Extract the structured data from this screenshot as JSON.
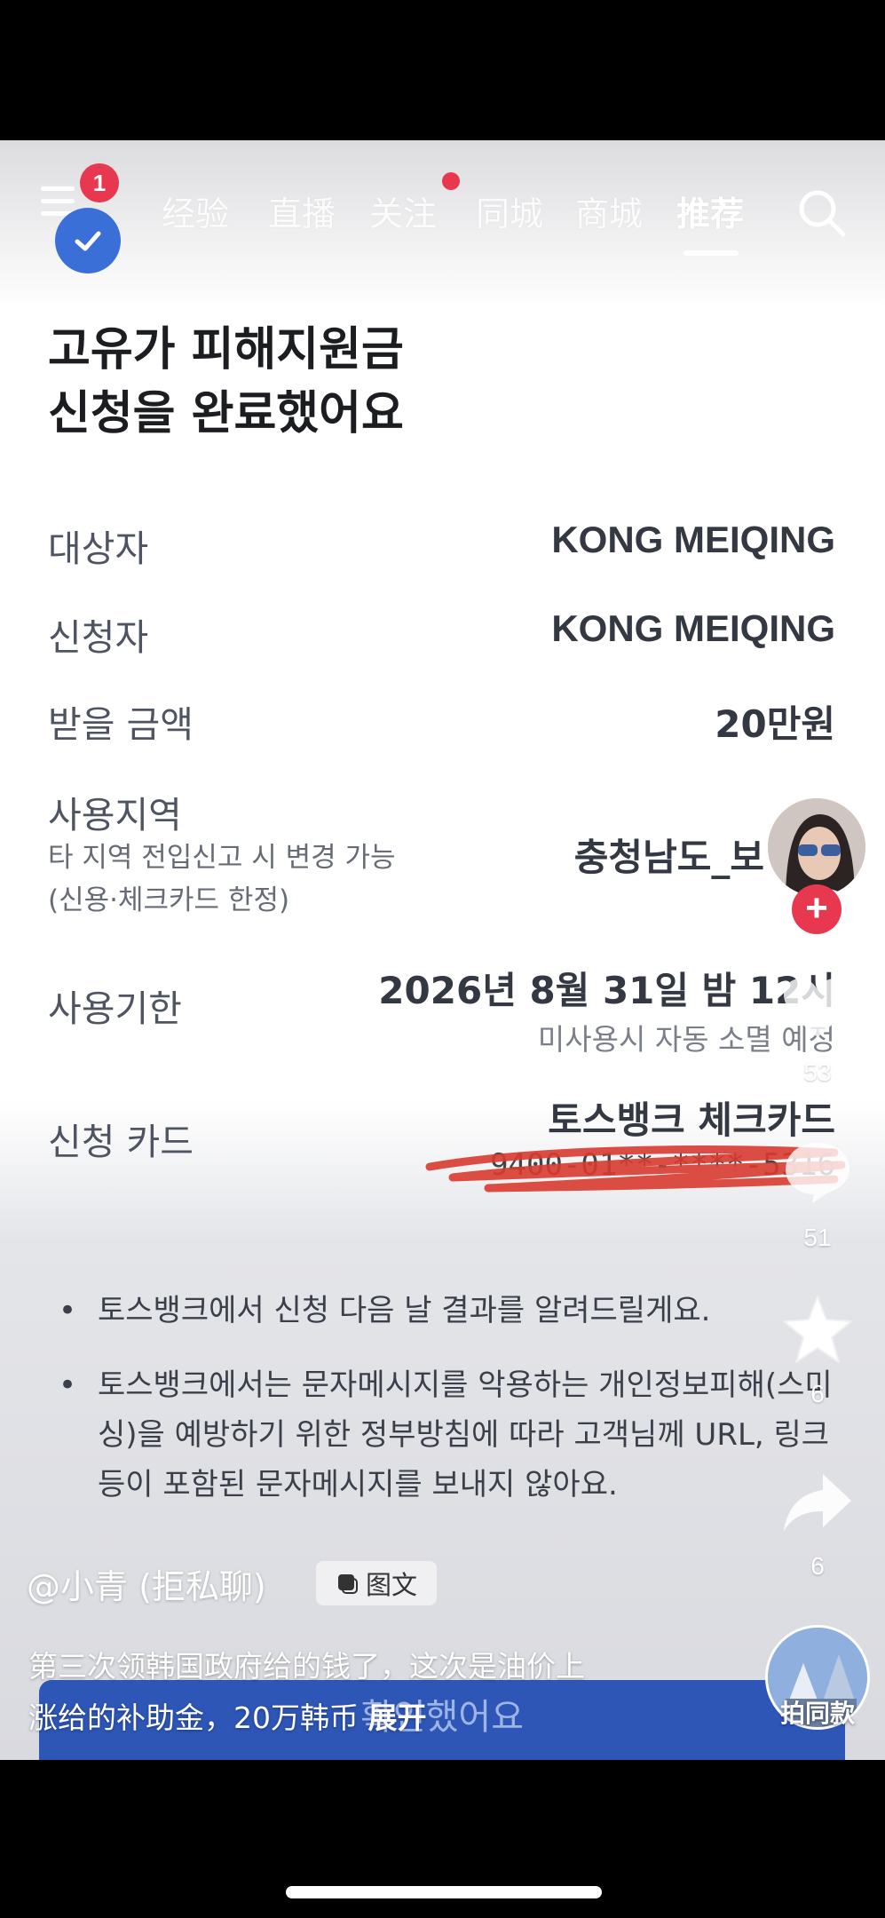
{
  "nav": {
    "menu_badge": "1",
    "tabs": [
      "经验",
      "直播",
      "关注",
      "同城",
      "商城",
      "推荐"
    ]
  },
  "doc": {
    "title_line1": "고유가 피해지원금",
    "title_line2": "신청을 완료했어요",
    "rows": {
      "target_label": "대상자",
      "target_value": "KONG MEIQING",
      "applicant_label": "신청자",
      "applicant_value": "KONG MEIQING",
      "amount_label": "받을 금액",
      "amount_value": "20만원",
      "region_label": "사용지역",
      "region_sub1": "타 지역 전입신고 시 변경 가능",
      "region_sub2": "(신용·체크카드 한정)",
      "region_value": "충청남도_보",
      "deadline_label": "사용기한",
      "deadline_value": "2026년 8월 31일 밤 12시",
      "deadline_note": "미사용시 자동 소멸 예정",
      "card_label": "신청 카드",
      "card_value": "토스뱅크 체크카드",
      "card_number": "9400-01**-****-5316"
    },
    "notices": [
      "토스뱅크에서 신청 다음 날 결과를 알려드릴게요.",
      "토스뱅크에서는 문자메시지를 악용하는 개인정보피해(스미싱)을 예방하기 위한 정부방침에 따라 고객님께 URL, 링크 등이 포함된 문자메시지를 보내지 않아요."
    ],
    "confirm_label": "확인했어요"
  },
  "social": {
    "author": "@小青 (拒私聊)",
    "post_type": "图文",
    "caption_line1": "第三次领韩国政府给的钱了，这次是油价上",
    "caption_line2": "涨给的补助金，20万韩币",
    "caption_more": "展开",
    "like_count": "53",
    "comment_count": "51",
    "favorite_count": "6",
    "share_count": "6",
    "same_style_label": "拍同款"
  },
  "icons": {
    "menu": "menu-icon",
    "verified": "check-icon",
    "search": "search-icon",
    "like": "heart-icon",
    "comment": "comment-icon",
    "favorite": "star-icon",
    "share": "share-icon",
    "follow": "plus-icon"
  },
  "colors": {
    "badge_red": "#e8384f",
    "verified_blue": "#3b6fd8",
    "confirm_blue": "#2d56b6",
    "redaction_red": "#d83a30"
  }
}
